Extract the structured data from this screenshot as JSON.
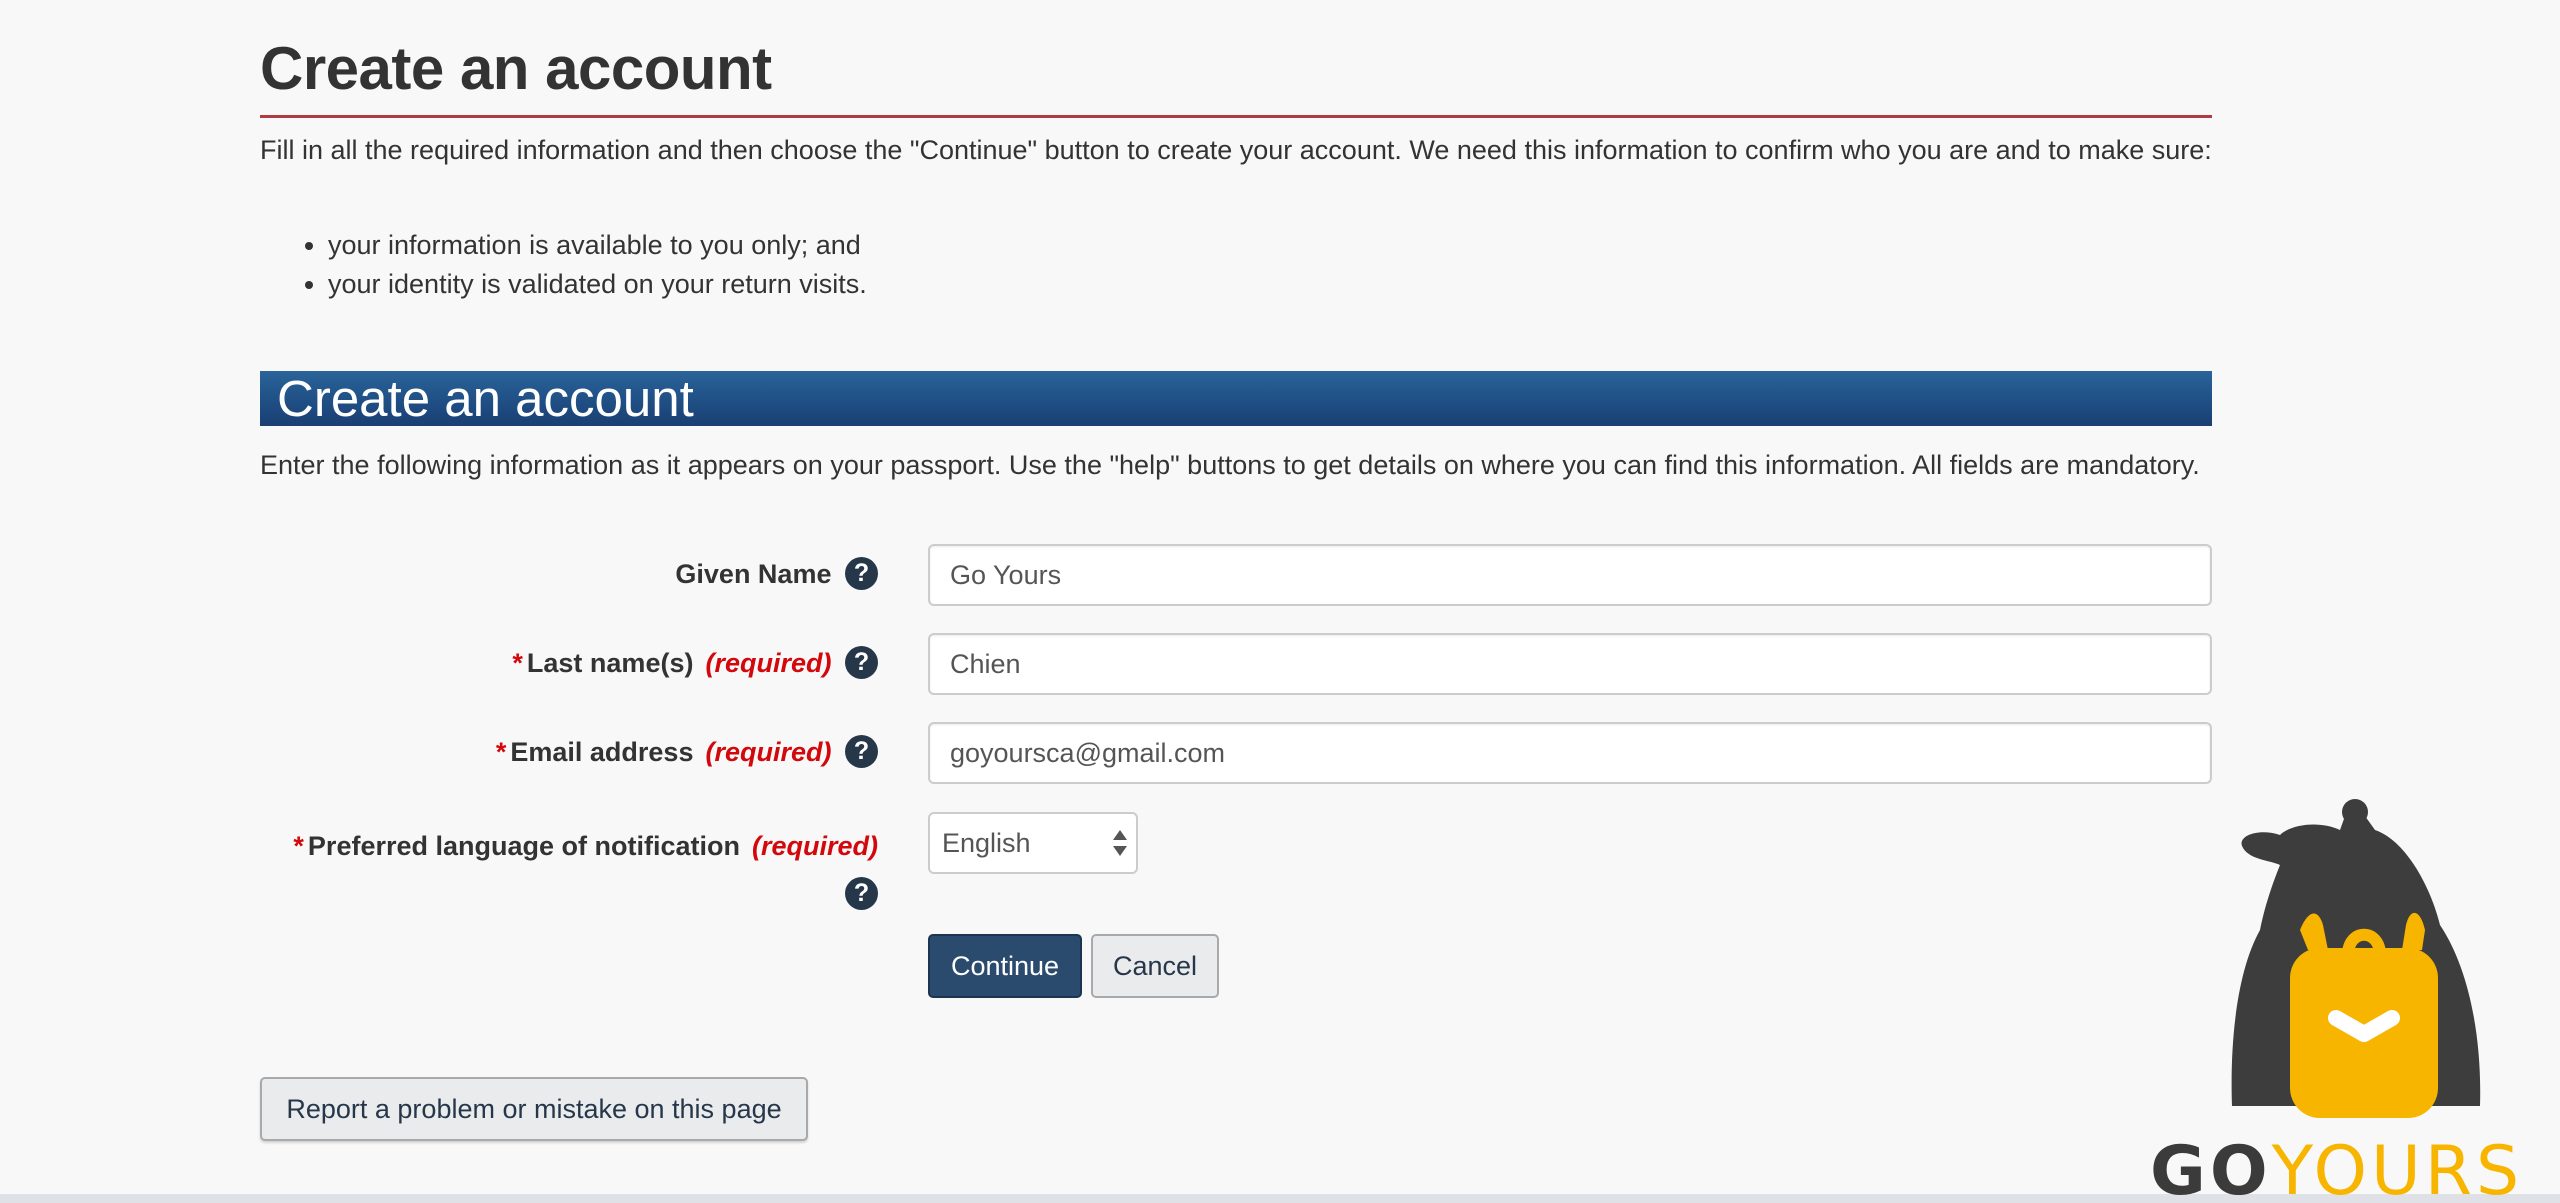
{
  "page": {
    "title": "Create an account",
    "intro": "Fill in all the required information and then choose the \"Continue\" button to create your account. We need this information to confirm who you are and to make sure:",
    "intro_list": [
      "your information is available to you only; and",
      "your identity is validated on your return visits."
    ]
  },
  "section": {
    "title": "Create an account",
    "intro": "Enter the following information as it appears on your passport. Use the \"help\" buttons to get details on where you can find this information. All fields are mandatory."
  },
  "form": {
    "required_marker": "*",
    "required_text": "(required)",
    "help_glyph": "?",
    "given_name": {
      "label": "Given Name",
      "value": "Go Yours"
    },
    "last_name": {
      "label": "Last name(s)",
      "value": "Chien"
    },
    "email": {
      "label": "Email address",
      "value": "goyoursca@gmail.com"
    },
    "language": {
      "label": "Preferred language of notification",
      "selected": "English"
    },
    "continue_label": "Continue",
    "cancel_label": "Cancel"
  },
  "report_label": "Report a problem or mistake on this page",
  "watermark": {
    "brand_part1": "GO",
    "brand_part2": "YOURS",
    "colors": {
      "dark": "#3b3b3b",
      "accent": "#f7b500"
    }
  },
  "colors": {
    "title_rule": "#af3c43",
    "banner": "#1f4f85",
    "required": "#d3080c",
    "primary_button": "#2b4b6e",
    "help_icon": "#26374a"
  },
  "icons": {
    "help": "help-circle-icon",
    "select": "select-arrows-icon"
  }
}
